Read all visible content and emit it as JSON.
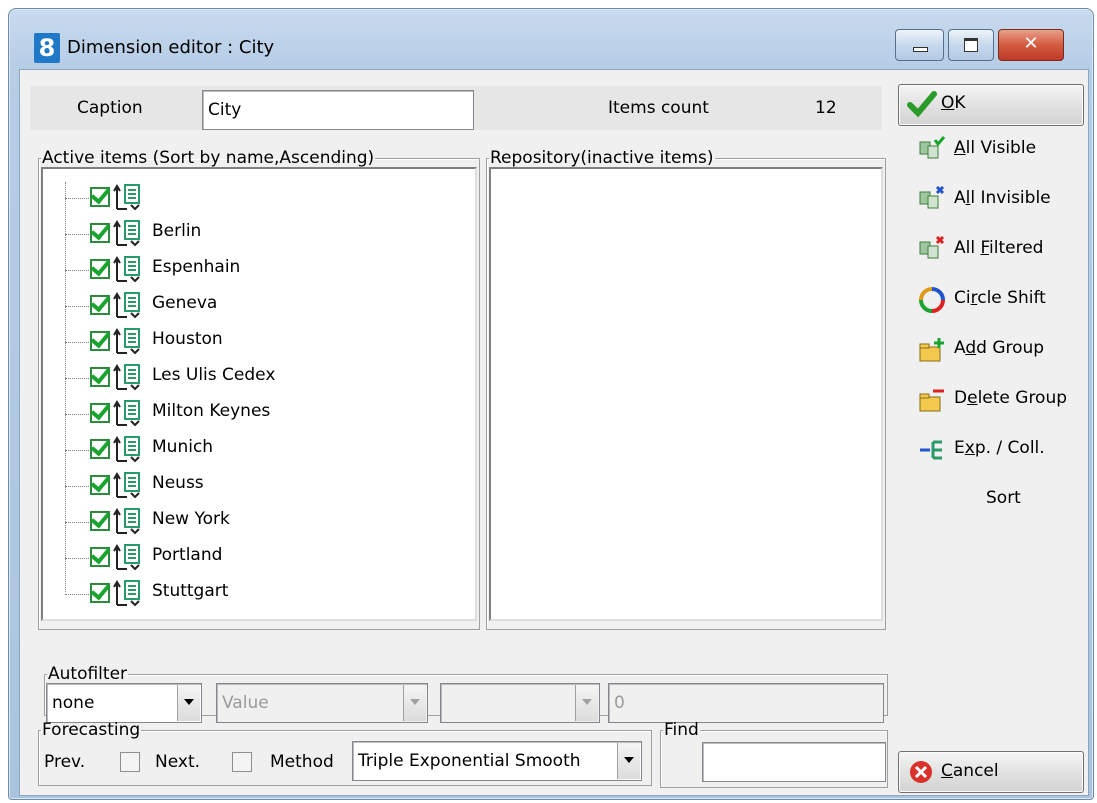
{
  "window": {
    "title": "Dimension editor : City",
    "app_icon": "8"
  },
  "caption": {
    "label": "Caption",
    "value": "City",
    "items_count_label": "Items count",
    "items_count": "12"
  },
  "active_items": {
    "title": "Active items (Sort by name,Ascending)",
    "items": [
      "",
      "Berlin",
      "Espenhain",
      "Geneva",
      "Houston",
      "Les Ulis Cedex",
      "Milton Keynes",
      "Munich",
      "Neuss",
      "New York",
      "Portland",
      "Stuttgart"
    ]
  },
  "repository": {
    "title": "Repository(inactive items)"
  },
  "autofilter": {
    "title": "Autofilter",
    "mode": "none",
    "field_placeholder": "Value",
    "operator": "",
    "value": "0"
  },
  "forecasting": {
    "title": "Forecasting",
    "prev_label": "Prev.",
    "next_label": "Next.",
    "method_label": "Method",
    "method_value": "Triple Exponential Smooth"
  },
  "find": {
    "title": "Find",
    "value": ""
  },
  "buttons": {
    "ok": {
      "accel": "O",
      "rest": "K"
    },
    "all_visible": {
      "accel": "A",
      "rest": "ll Visible"
    },
    "all_invisible": {
      "pre": "A",
      "accel": "l",
      "rest": "l Invisible"
    },
    "all_filtered": {
      "pre": "All ",
      "accel": "F",
      "rest": "iltered"
    },
    "circle_shift": {
      "pre": "Ci",
      "accel": "r",
      "rest": "cle Shift"
    },
    "add_group": {
      "pre": "A",
      "accel": "d",
      "rest": "d Group"
    },
    "delete_group": {
      "pre": "D",
      "accel": "e",
      "rest": "lete Group"
    },
    "exp_coll": {
      "pre": "E",
      "accel": "x",
      "rest": "p. / Coll."
    },
    "sort": "Sort",
    "cancel": {
      "accel": "C",
      "rest": "ancel"
    }
  },
  "colors": {
    "accent_green": "#1aa32e",
    "title_bar": "#b6cde6",
    "close_red": "#c0392b"
  }
}
